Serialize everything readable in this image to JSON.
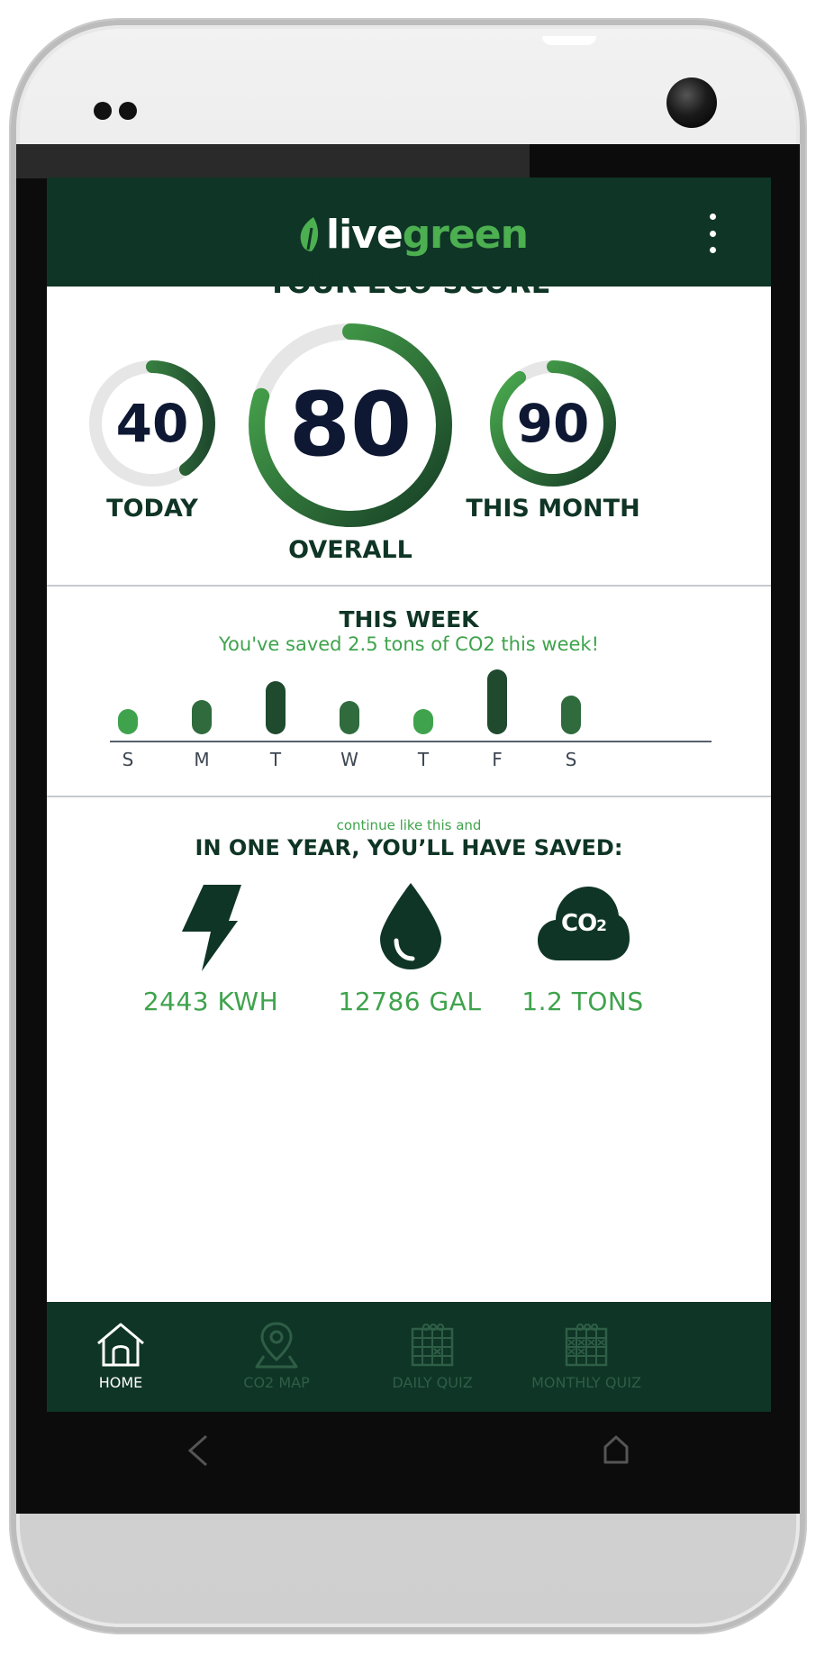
{
  "app": {
    "logo_live": "live",
    "logo_green": "green",
    "menu_icon": "more-vertical-icon"
  },
  "eco_score": {
    "title": "YOUR ECO SCORE",
    "today": {
      "value": "40",
      "label": "TODAY",
      "progress": 0.4
    },
    "overall": {
      "value": "80",
      "label": "OVERALL",
      "progress": 0.8
    },
    "month": {
      "value": "90",
      "label": "THIS MONTH",
      "progress": 0.9
    }
  },
  "week": {
    "title": "THIS WEEK",
    "subtitle": "You've saved 2.5 tons of CO2 this week!",
    "days": [
      {
        "label": "S",
        "level": 0.15
      },
      {
        "label": "M",
        "level": 0.35
      },
      {
        "label": "T",
        "level": 0.75
      },
      {
        "label": "W",
        "level": 0.32
      },
      {
        "label": "T",
        "level": 0.15
      },
      {
        "label": "F",
        "level": 1.0
      },
      {
        "label": "S",
        "level": 0.45
      }
    ]
  },
  "projection": {
    "lead": "continue like this and",
    "title": "IN ONE YEAR, YOU’LL HAVE SAVED:",
    "stats": [
      {
        "icon": "lightning-icon",
        "value": "2443 KWH"
      },
      {
        "icon": "water-drop-icon",
        "value": "12786 GAL"
      },
      {
        "icon": "co2-cloud-icon",
        "value": "1.2 TONS"
      }
    ],
    "co2_icon_text": "CO",
    "co2_icon_sub": "2"
  },
  "nav": {
    "items": [
      {
        "label": "HOME",
        "icon": "home-icon",
        "active": true
      },
      {
        "label": "CO2 MAP",
        "icon": "map-pin-icon",
        "active": false
      },
      {
        "label": "DAILY QUIZ",
        "icon": "calendar-icon",
        "active": false
      },
      {
        "label": "MONTHLY QUIZ",
        "icon": "calendar-grid-icon",
        "active": false
      }
    ]
  },
  "colors": {
    "dark_green": "#0f3526",
    "accent_green": "#4caf50",
    "number_navy": "#0e1833",
    "nav_inactive": "#2f5e47"
  }
}
